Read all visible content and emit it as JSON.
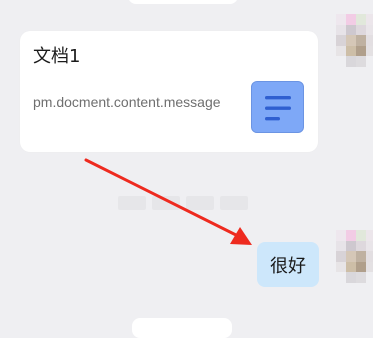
{
  "document_card": {
    "title": "文档1",
    "description": "pm.docment.content.message",
    "icon": "document-lines-icon"
  },
  "reply_message": {
    "text": "很好"
  },
  "annotation": {
    "icon": "red-arrow-icon",
    "color": "#ee2a1f"
  },
  "colors": {
    "background": "#efeff2",
    "reply_bubble": "#cde7fb",
    "doc_icon_bg": "#7ea8f7",
    "doc_icon_lines": "#2f5fd0"
  }
}
